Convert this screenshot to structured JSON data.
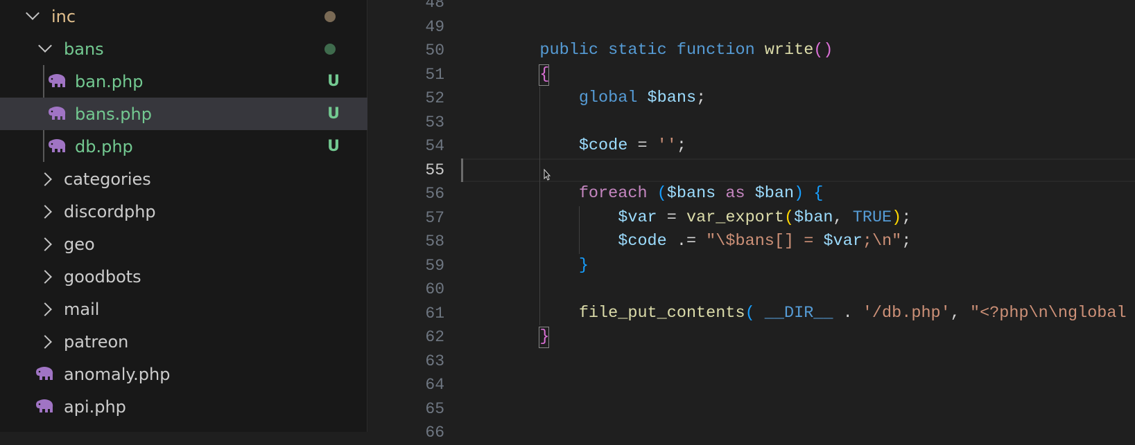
{
  "explorer": {
    "items": [
      {
        "label": "inc",
        "type": "folder",
        "expanded": true,
        "color": "#e2c08d",
        "decoration": "dot",
        "dot_color": "#7a6a55"
      },
      {
        "label": "bans",
        "type": "folder",
        "expanded": true,
        "color": "#73c991",
        "decoration": "dot",
        "dot_color": "#3f6b4d"
      },
      {
        "label": "ban.php",
        "type": "php-file",
        "color": "#73c991",
        "badge": "U"
      },
      {
        "label": "bans.php",
        "type": "php-file",
        "color": "#73c991",
        "badge": "U",
        "selected": true
      },
      {
        "label": "db.php",
        "type": "php-file",
        "color": "#73c991",
        "badge": "U"
      },
      {
        "label": "categories",
        "type": "folder",
        "expanded": false
      },
      {
        "label": "discordphp",
        "type": "folder",
        "expanded": false
      },
      {
        "label": "geo",
        "type": "folder",
        "expanded": false
      },
      {
        "label": "goodbots",
        "type": "folder",
        "expanded": false
      },
      {
        "label": "mail",
        "type": "folder",
        "expanded": false
      },
      {
        "label": "patreon",
        "type": "folder",
        "expanded": false
      },
      {
        "label": "anomaly.php",
        "type": "php-file"
      },
      {
        "label": "api.php",
        "type": "php-file"
      }
    ]
  },
  "editor": {
    "current_line": 55,
    "lines": [
      {
        "n": "48",
        "tokens": []
      },
      {
        "n": "49",
        "tokens": []
      },
      {
        "n": "50",
        "tokens": [
          [
            "    ",
            "t"
          ],
          [
            "public static function ",
            "k"
          ],
          [
            "write",
            "f"
          ],
          [
            "()",
            "p1"
          ]
        ]
      },
      {
        "n": "51",
        "tokens": [
          [
            "    ",
            "t"
          ],
          [
            "{",
            "p1"
          ]
        ]
      },
      {
        "n": "52",
        "tokens": [
          [
            "        ",
            "t"
          ],
          [
            "global ",
            "k"
          ],
          [
            "$bans",
            "v"
          ],
          [
            ";",
            "t"
          ]
        ]
      },
      {
        "n": "53",
        "tokens": []
      },
      {
        "n": "54",
        "tokens": [
          [
            "        ",
            "t"
          ],
          [
            "$code",
            "v"
          ],
          [
            " = ",
            "t"
          ],
          [
            "''",
            "s"
          ],
          [
            ";",
            "t"
          ]
        ]
      },
      {
        "n": "55",
        "tokens": []
      },
      {
        "n": "56",
        "tokens": [
          [
            "        ",
            "t"
          ],
          [
            "foreach ",
            "c"
          ],
          [
            "(",
            "p2"
          ],
          [
            "$bans",
            "v"
          ],
          [
            " as ",
            "c"
          ],
          [
            "$ban",
            "v"
          ],
          [
            ")",
            "p2"
          ],
          [
            " ",
            "t"
          ],
          [
            "{",
            "p2"
          ]
        ]
      },
      {
        "n": "57",
        "tokens": [
          [
            "            ",
            "t"
          ],
          [
            "$var",
            "v"
          ],
          [
            " = ",
            "t"
          ],
          [
            "var_export",
            "f"
          ],
          [
            "(",
            "p3"
          ],
          [
            "$ban",
            "v"
          ],
          [
            ", ",
            "t"
          ],
          [
            "TRUE",
            "k"
          ],
          [
            ")",
            "p3"
          ],
          [
            ";",
            "t"
          ]
        ]
      },
      {
        "n": "58",
        "tokens": [
          [
            "            ",
            "t"
          ],
          [
            "$code",
            "v"
          ],
          [
            " .= ",
            "t"
          ],
          [
            "\"\\",
            "s"
          ],
          [
            "$bans",
            "s"
          ],
          [
            "[]",
            "s"
          ],
          [
            " = ",
            "s"
          ],
          [
            "$var",
            "v"
          ],
          [
            ";\\n\"",
            "s"
          ],
          [
            ";",
            "t"
          ]
        ]
      },
      {
        "n": "59",
        "tokens": [
          [
            "        ",
            "t"
          ],
          [
            "}",
            "p2"
          ]
        ]
      },
      {
        "n": "60",
        "tokens": []
      },
      {
        "n": "61",
        "tokens": [
          [
            "        ",
            "t"
          ],
          [
            "file_put_contents",
            "f"
          ],
          [
            "( ",
            "p2"
          ],
          [
            "__DIR__",
            "k"
          ],
          [
            " . ",
            "t"
          ],
          [
            "'/db.php'",
            "s"
          ],
          [
            ", ",
            "t"
          ],
          [
            "\"<?php\\n\\nglobal \\$b",
            "s"
          ]
        ]
      },
      {
        "n": "62",
        "tokens": [
          [
            "    ",
            "t"
          ],
          [
            "}",
            "p1"
          ]
        ]
      },
      {
        "n": "63",
        "tokens": []
      },
      {
        "n": "64",
        "tokens": []
      },
      {
        "n": "65",
        "tokens": []
      },
      {
        "n": "66",
        "tokens": []
      }
    ]
  }
}
